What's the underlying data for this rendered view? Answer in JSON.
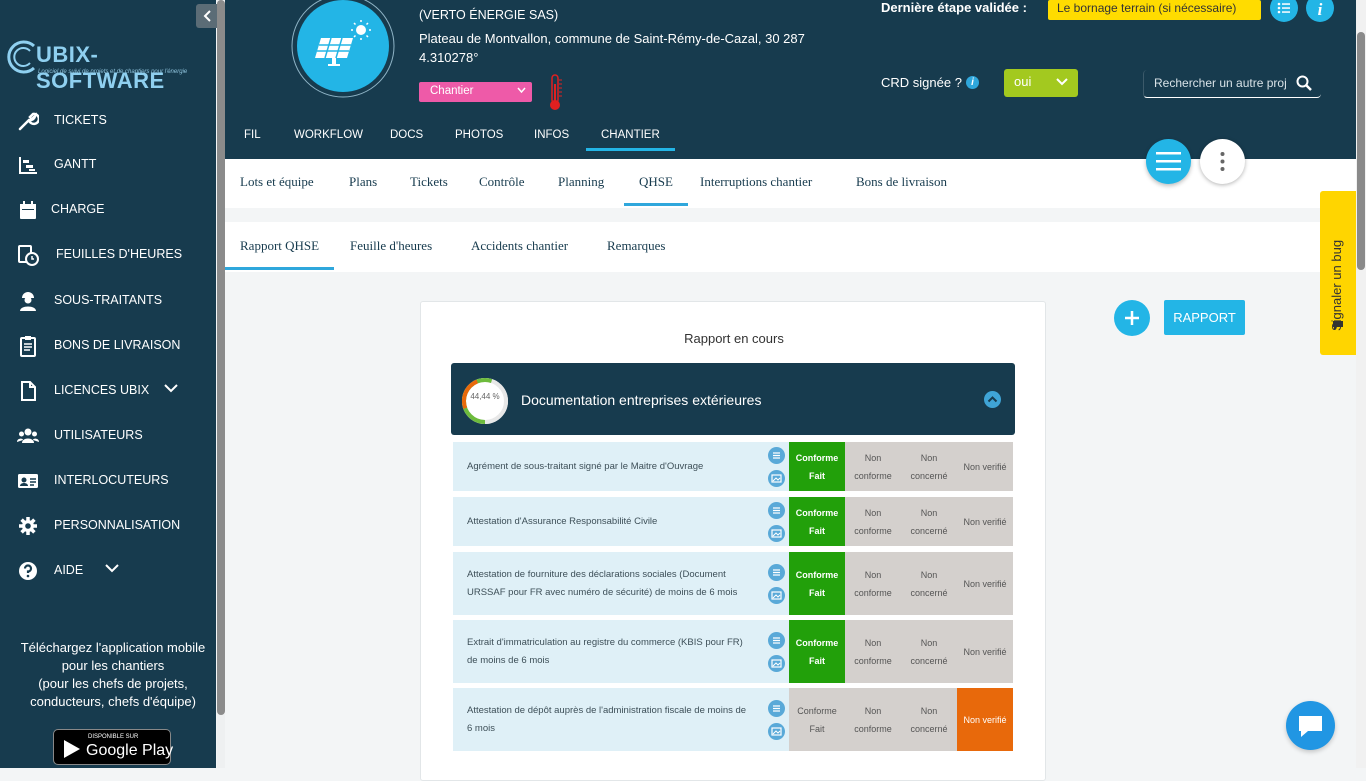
{
  "sidebar": {
    "logo_text": "UBIX-SOFTWARE",
    "logo_tagline": "Logiciel de suivi de projets et de chantiers pour l'énergie",
    "items": [
      {
        "label": "TICKETS",
        "icon": "wrench-icon"
      },
      {
        "label": "GANTT",
        "icon": "gantt-icon"
      },
      {
        "label": "CHARGE",
        "icon": "calendar-icon"
      },
      {
        "label": "FEUILLES D'HEURES",
        "icon": "timesheet-icon"
      },
      {
        "label": "SOUS-TRAITANTS",
        "icon": "worker-icon"
      },
      {
        "label": "BONS DE LIVRAISON",
        "icon": "clipboard-icon"
      },
      {
        "label": "LICENCES UBIX",
        "icon": "document-icon"
      },
      {
        "label": "UTILISATEURS",
        "icon": "users-icon"
      },
      {
        "label": "INTERLOCUTEURS",
        "icon": "id-card-icon"
      },
      {
        "label": "PERSONNALISATION",
        "icon": "gear-icon"
      },
      {
        "label": "AIDE",
        "icon": "help-icon"
      }
    ],
    "download_text_1": "Téléchargez l'application mobile",
    "download_text_2": "pour les chantiers",
    "download_text_3": "(pour les chefs de projets,",
    "download_text_4": "conducteurs, chefs d'équipe)",
    "store_small": "DISPONIBLE SUR",
    "store_big": "Google Play"
  },
  "header": {
    "company": "(VERTO ÉNERGIE SAS)",
    "address_line1": "Plateau de Montvallon, commune de Saint-Rémy-de-Cazal, 30 287",
    "address_line2": "4.310278°",
    "status_value": "Chantier",
    "step_label": "Dernière étape validée :",
    "step_value": "Le bornage terrain (si nécessaire)",
    "crd_label": "CRD signée ?",
    "crd_info": "i",
    "crd_value": "oui",
    "search_placeholder": "Rechercher un autre projet"
  },
  "tabs_main": [
    "FIL",
    "WORKFLOW",
    "DOCS",
    "PHOTOS",
    "INFOS",
    "CHANTIER"
  ],
  "tabs_chantier": [
    "Lots et équipe",
    "Plans",
    "Tickets",
    "Contrôle",
    "Planning",
    "QHSE",
    "Interruptions chantier",
    "Bons de livraison"
  ],
  "tabs_qhse": [
    "Rapport QHSE",
    "Feuille d'heures",
    "Accidents chantier",
    "Remarques"
  ],
  "report": {
    "title": "Rapport en cours",
    "section_title": "Documentation entreprises extérieures",
    "section_progress_label": "44,44 %",
    "section_progress": 0.4444,
    "add_button": "+",
    "rapport_button": "RAPPORT",
    "options": [
      "Conforme Fait",
      "Non conforme",
      "Non concerné",
      "Non verifié"
    ],
    "rows": [
      {
        "text": "Agrément de sous-traitant signé par le Maitre d'Ouvrage",
        "selected": 0
      },
      {
        "text": "Attestation d'Assurance Responsabilité Civile",
        "selected": 0
      },
      {
        "text": "Attestation de fourniture des déclarations sociales (Document URSSAF pour FR avec numéro de sécurité) de moins de 6 mois",
        "selected": 0
      },
      {
        "text": "Extrait d'immatriculation au registre du commerce (KBIS pour FR) de moins de 6 mois",
        "selected": 0
      },
      {
        "text": "Attestation de dépôt auprès de l'administration fiscale de moins de 6 mois",
        "selected": 3
      }
    ]
  },
  "bug_report": "Signaler un bug",
  "colors": {
    "primary_dark": "#173b4e",
    "accent": "#23b5e6",
    "conforme": "#22a00a",
    "non_verifie": "#e8690b",
    "status_pink": "#ee5aa8",
    "step_yellow": "#ffdc00",
    "oui_green": "#a3c91f"
  }
}
